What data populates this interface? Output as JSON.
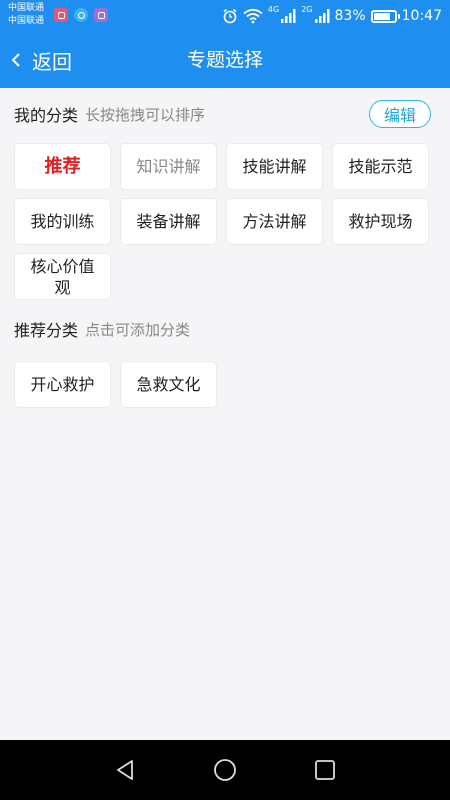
{
  "status_bar": {
    "carrier_1": "中国联通",
    "carrier_2": "中国联通",
    "network_1": "4G",
    "network_2": "2G",
    "battery_text": "83%",
    "battery_level": 0.83,
    "time": "10:47"
  },
  "app_bar": {
    "back_label": "返回",
    "title": "专题选择"
  },
  "my_categories": {
    "title": "我的分类",
    "hint": "长按拖拽可以排序",
    "edit_label": "编辑",
    "items": [
      {
        "label": "推荐",
        "selected": true
      },
      {
        "label": "知识讲解",
        "muted": true
      },
      {
        "label": "技能讲解"
      },
      {
        "label": "技能示范"
      },
      {
        "label": "我的训练"
      },
      {
        "label": "装备讲解"
      },
      {
        "label": "方法讲解"
      },
      {
        "label": "救护现场"
      },
      {
        "label": "核心价值观"
      }
    ]
  },
  "recommended_categories": {
    "title": "推荐分类",
    "hint": "点击可添加分类",
    "items": [
      {
        "label": "开心救护"
      },
      {
        "label": "急救文化"
      }
    ]
  },
  "theme": {
    "primary": "#1e8ef0",
    "selected_text": "#e02020",
    "edit_accent": "#29b6e0"
  }
}
